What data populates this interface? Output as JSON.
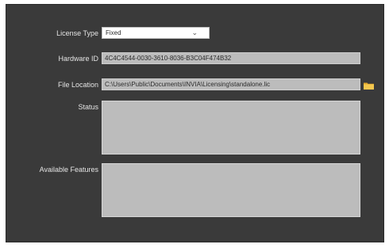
{
  "form": {
    "license_type": {
      "label": "License Type",
      "value": "Fixed"
    },
    "hardware_id": {
      "label": "Hardware ID",
      "value": "4C4C4544-0030-3610-8036-B3C04F474B32"
    },
    "file_location": {
      "label": "File Location",
      "value": "C:\\Users\\Public\\Documents\\INVIA\\Licensing\\standalone.lic"
    },
    "status": {
      "label": "Status",
      "value": ""
    },
    "available_features": {
      "label": "Available Features",
      "value": ""
    }
  },
  "icons": {
    "license_type_dropdown": "chevron-down-icon",
    "file_location_browse": "folder-icon"
  },
  "colors": {
    "panel_background": "#3a3a3a",
    "field_background": "#bcbcbc",
    "label_text": "#e4e4e4",
    "folder_icon": "#f2c24a"
  }
}
